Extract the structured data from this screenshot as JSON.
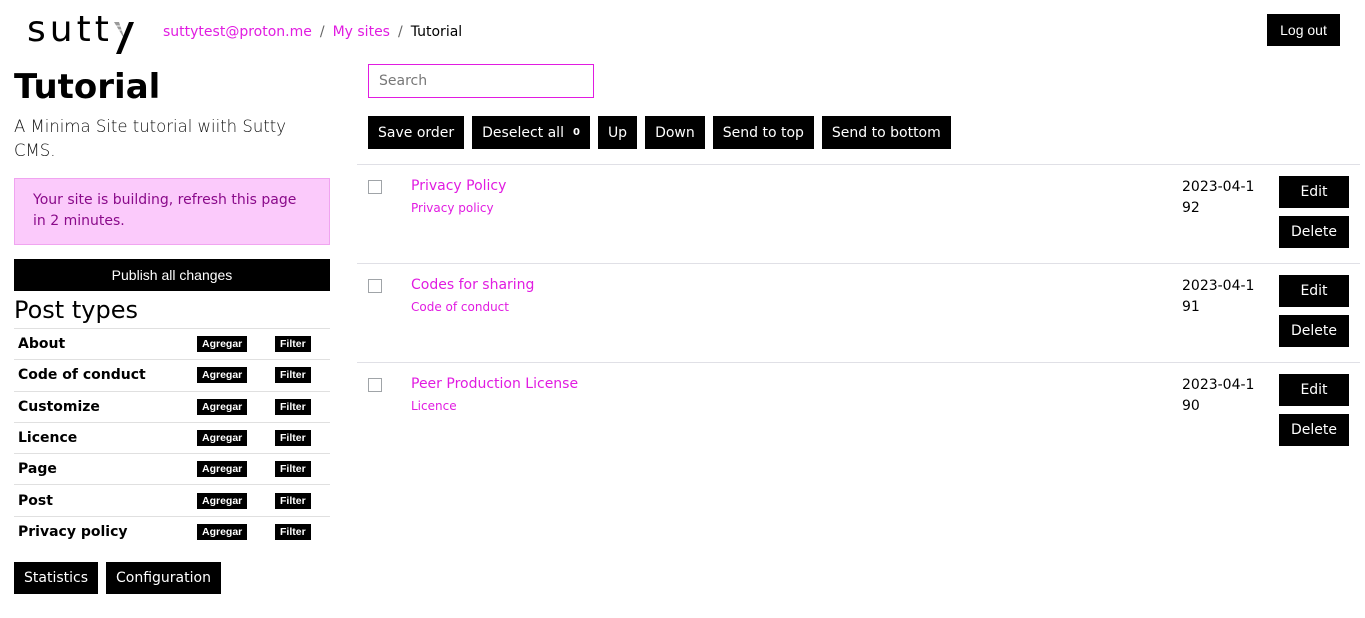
{
  "header": {
    "logo_text": "sutt",
    "breadcrumb": [
      {
        "label": "suttytest@proton.me",
        "link": true
      },
      {
        "label": "My sites",
        "link": true
      },
      {
        "label": "Tutorial",
        "link": false
      }
    ],
    "separator": "/",
    "logout_label": "Log out"
  },
  "sidebar": {
    "site_title": "Tutorial",
    "site_description": "A Minima Site tutorial wiith Sutty CMS.",
    "alert_text": "Your site is building, refresh this page in 2 minutes.",
    "publish_label": "Publish all changes",
    "post_types_title": "Post types",
    "add_label": "Agregar",
    "filter_label": "Filter",
    "post_types": [
      "About",
      "Code of conduct",
      "Customize",
      "Licence",
      "Page",
      "Post",
      "Privacy policy"
    ],
    "statistics_label": "Statistics",
    "configuration_label": "Configuration"
  },
  "main": {
    "search_placeholder": "Search",
    "search_value": "",
    "toolbar": {
      "save_order": "Save order",
      "deselect_all": "Deselect all",
      "selected_count": "0",
      "up": "Up",
      "down": "Down",
      "send_to_top": "Send to top",
      "send_to_bottom": "Send to bottom"
    },
    "edit_label": "Edit",
    "delete_label": "Delete",
    "posts": [
      {
        "title": "Privacy Policy",
        "type": "Privacy policy",
        "date": "2023-04-192"
      },
      {
        "title": "Codes for sharing",
        "type": "Code of conduct",
        "date": "2023-04-191"
      },
      {
        "title": "Peer Production License",
        "type": "Licence",
        "date": "2023-04-190"
      }
    ]
  },
  "colors": {
    "accent": "#e11ce1",
    "alert_bg": "#fbcafb",
    "alert_text": "#8a0a8a",
    "button_bg": "#000000"
  }
}
